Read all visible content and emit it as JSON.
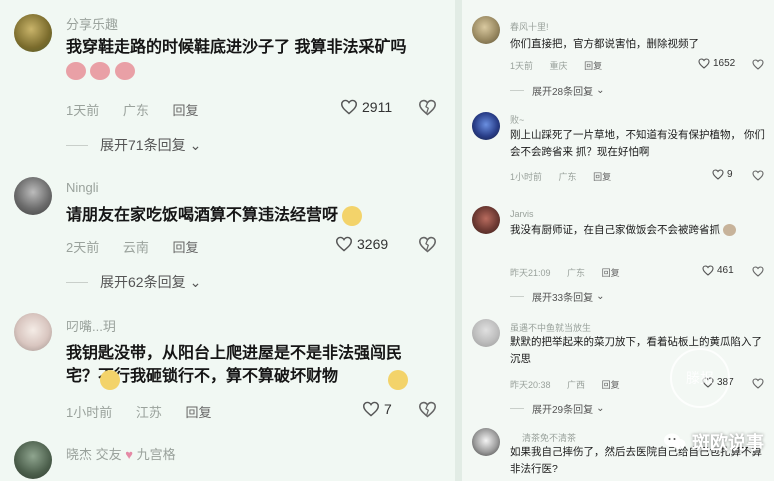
{
  "left": {
    "comments": [
      {
        "user": "分享乐趣",
        "text": "我穿鞋走路的时候鞋底进沙子了 我算非法采矿吗",
        "emojis": [
          "pig",
          "pig",
          "pig"
        ],
        "time": "1天前",
        "location": "广东",
        "reply": "回复",
        "likes": "2911",
        "expand": "展开71条回复"
      },
      {
        "user": "Ningli",
        "text": "请朋友在家吃饭喝酒算不算违法经营呀",
        "emojis": [
          "scared"
        ],
        "time": "2天前",
        "location": "云南",
        "reply": "回复",
        "likes": "3269",
        "expand": "展开62条回复"
      },
      {
        "user": "叼嘴...玥",
        "text": "我钥匙没带，从阳台上爬进屋是不是非法强闯民宅？不行我砸锁行不，算不算破坏财物",
        "emojis": [
          "scared",
          "scared"
        ],
        "time": "1小时前",
        "location": "江苏",
        "reply": "回复",
        "likes": "7"
      },
      {
        "user": "晓杰 交友",
        "user_suffix": "九宫格"
      }
    ]
  },
  "right": {
    "comments": [
      {
        "user": "春风十里!",
        "text": "你们直接把，官方都说害怕，删除视频了",
        "time": "1天前",
        "location": "重庆",
        "reply": "回复",
        "likes": "1652",
        "expand": "展开28条回复"
      },
      {
        "user": "败~",
        "text": "刚上山踩死了一片草地，不知道有没有保护植物， 你们会不会跨省来 抓？现在好怕啊",
        "time": "1小时前",
        "location": "广东",
        "reply": "回复",
        "likes": "9"
      },
      {
        "user": "Jarvis",
        "text": "我没有厨师证，在自己家做饭会不会被跨省抓",
        "emojis": [
          "dog"
        ],
        "time": "昨天21:09",
        "location": "广东",
        "reply": "回复",
        "likes": "461",
        "expand": "展开33条回复"
      },
      {
        "user": "虽遇不中鱼就当放生",
        "text": "默默的把举起来的菜刀放下，看着砧板上的黄瓜陷入了沉思",
        "time": "昨天20:38",
        "location": "广西",
        "reply": "回复",
        "likes": "387",
        "expand": "展开29条回复"
      },
      {
        "user": "清茶免不清茶",
        "text": "如果我自己摔伤了，然后去医院自己给自己包扎算不算非法行医?"
      }
    ]
  },
  "watermark": {
    "text": "斑欧说事",
    "logo_text": "滕报"
  },
  "colors": {
    "background": "#f1f8f3",
    "meta": "#9aa29c",
    "text": "#151515"
  }
}
